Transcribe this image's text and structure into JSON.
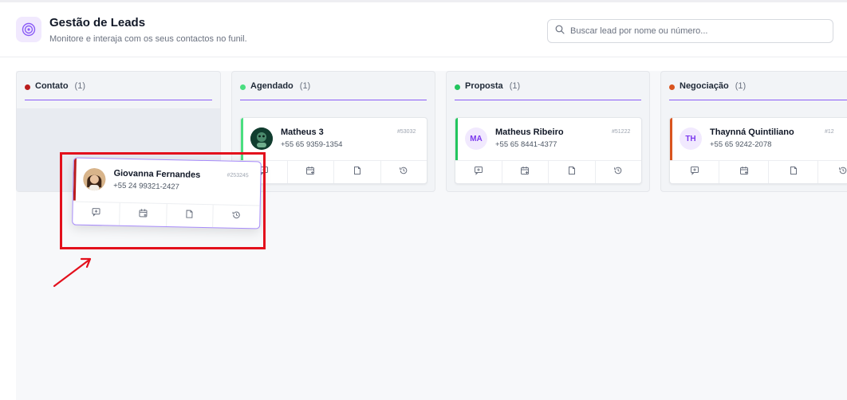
{
  "header": {
    "title": "Gestão de Leads",
    "subtitle": "Monitore e interaja com os seus contactos no funil.",
    "search_placeholder": "Buscar lead por nome ou número..."
  },
  "colors": {
    "accent": "#8b5cf6",
    "contato": "#b91c1c",
    "agendado": "#4ade80",
    "proposta": "#22c55e",
    "negociacao": "#d9541e",
    "highlight": "#e3101c"
  },
  "columns": [
    {
      "name": "Contato",
      "count": "(1)"
    },
    {
      "name": "Agendado",
      "count": "(1)"
    },
    {
      "name": "Proposta",
      "count": "(1)"
    },
    {
      "name": "Negociação",
      "count": "(1)"
    }
  ],
  "cards": {
    "dragging": {
      "name": "Giovanna Fernandes",
      "phone": "+55 24 99321-2427",
      "id": "#253245",
      "avatar": "photo"
    },
    "agendado": {
      "name": "Matheus 3",
      "phone": "+55 65 9359-1354",
      "id": "#53032",
      "avatar": "photo"
    },
    "proposta": {
      "name": "Matheus Ribeiro",
      "phone": "+55 65 8441-4377",
      "id": "#51222",
      "initials": "MA"
    },
    "negociacao": {
      "name": "Thaynná Quintiliano",
      "phone": "+55 65 9242-2078",
      "id": "#12",
      "initials": "TH"
    }
  },
  "icons": [
    "target-icon",
    "search-icon",
    "message-plus-icon",
    "calendar-plus-icon",
    "note-icon",
    "history-icon"
  ]
}
